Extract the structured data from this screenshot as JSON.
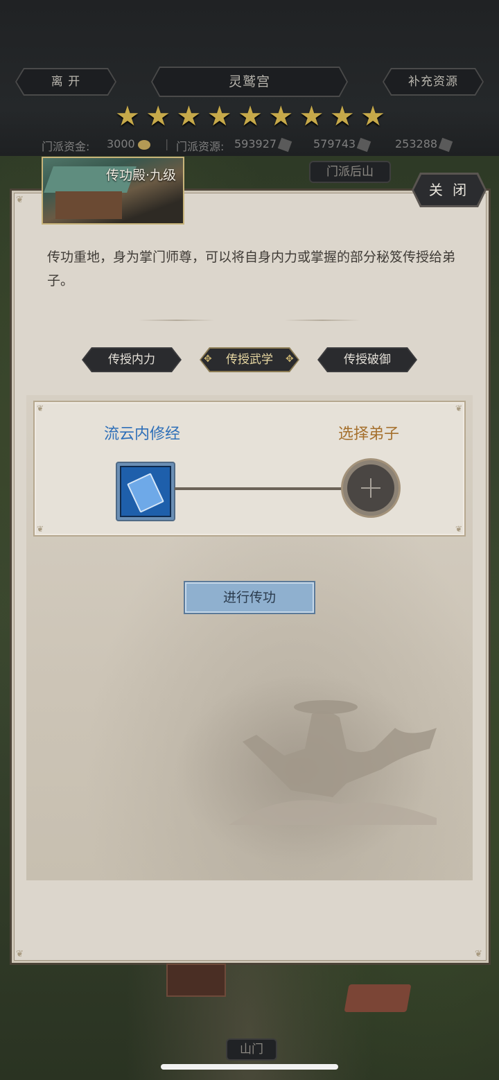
{
  "header": {
    "leave_label": "离 开",
    "title": "灵鹫宫",
    "replenish_label": "补充资源",
    "star_count": 9,
    "resources": {
      "funds_label": "门派资金:",
      "funds_value": "3000",
      "res_label": "门派资源:",
      "res_value": "593927",
      "res2_value": "579743",
      "res3_value": "253288"
    }
  },
  "map": {
    "mountain_label": "门派后山",
    "gate_label": "山门"
  },
  "panel": {
    "building_title": "传功殿·九级",
    "close_label": "关 闭",
    "description": "传功重地，身为掌门师尊，可以将自身内力或掌握的部分秘笈传授给弟子。",
    "tabs": [
      {
        "label": "传授内力"
      },
      {
        "label": "传授武学"
      },
      {
        "label": "传授破御"
      }
    ],
    "active_tab": 1,
    "skill_name": "流云内修经",
    "pick_label": "选择弟子",
    "go_label": "进行传功"
  },
  "colors": {
    "skill_blue": "#2e6fb8",
    "pick_gold": "#a5702d",
    "star_gold": "#c6a94a"
  }
}
